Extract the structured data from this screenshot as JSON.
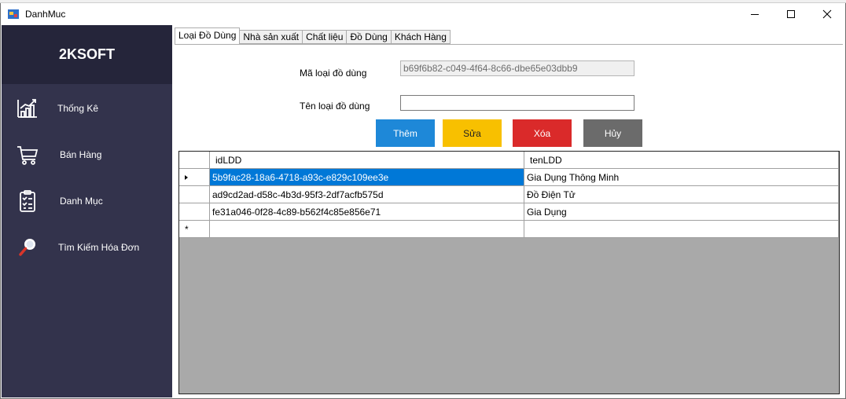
{
  "window": {
    "title": "DanhMuc"
  },
  "sidebar": {
    "brand": "2KSOFT",
    "items": [
      {
        "label": "Thống Kê",
        "icon": "chart-icon"
      },
      {
        "label": "Bán Hàng",
        "icon": "cart-icon"
      },
      {
        "label": "Danh Mục",
        "icon": "checklist-icon"
      },
      {
        "label": "Tìm Kiếm Hóa Đơn",
        "icon": "search-icon"
      }
    ]
  },
  "tabs": [
    "Loại Đồ Dùng",
    "Nhà sản xuất",
    "Chất liệu",
    "Đồ Dùng",
    "Khách Hàng"
  ],
  "form": {
    "id_label": "Mã loại đồ dùng",
    "id_value": "b69f6b82-c049-4f64-8c66-dbe65e03dbb9",
    "name_label": "Tên loại đồ dùng",
    "name_value": ""
  },
  "buttons": {
    "add": "Thêm",
    "edit": "Sửa",
    "delete": "Xóa",
    "cancel": "Hủy"
  },
  "colors": {
    "add": "#1e88d8",
    "edit": "#f8c000",
    "delete": "#da2a2a",
    "cancel": "#6b6b6b",
    "sidebar": "#33334c",
    "brand": "#25253a"
  },
  "grid": {
    "columns": [
      "idLDD",
      "tenLDD"
    ],
    "rows": [
      {
        "id": "5b9fac28-18a6-4718-a93c-e829c109ee3e",
        "name": "Gia Dụng Thông Minh"
      },
      {
        "id": "ad9cd2ad-d58c-4b3d-95f3-2df7acfb575d",
        "name": "Đồ Điện Tử"
      },
      {
        "id": "fe31a046-0f28-4c89-b562f4c85e856e71",
        "name": "Gia Dụng"
      }
    ],
    "current_row_marker": "▸",
    "new_row_marker": "*"
  }
}
